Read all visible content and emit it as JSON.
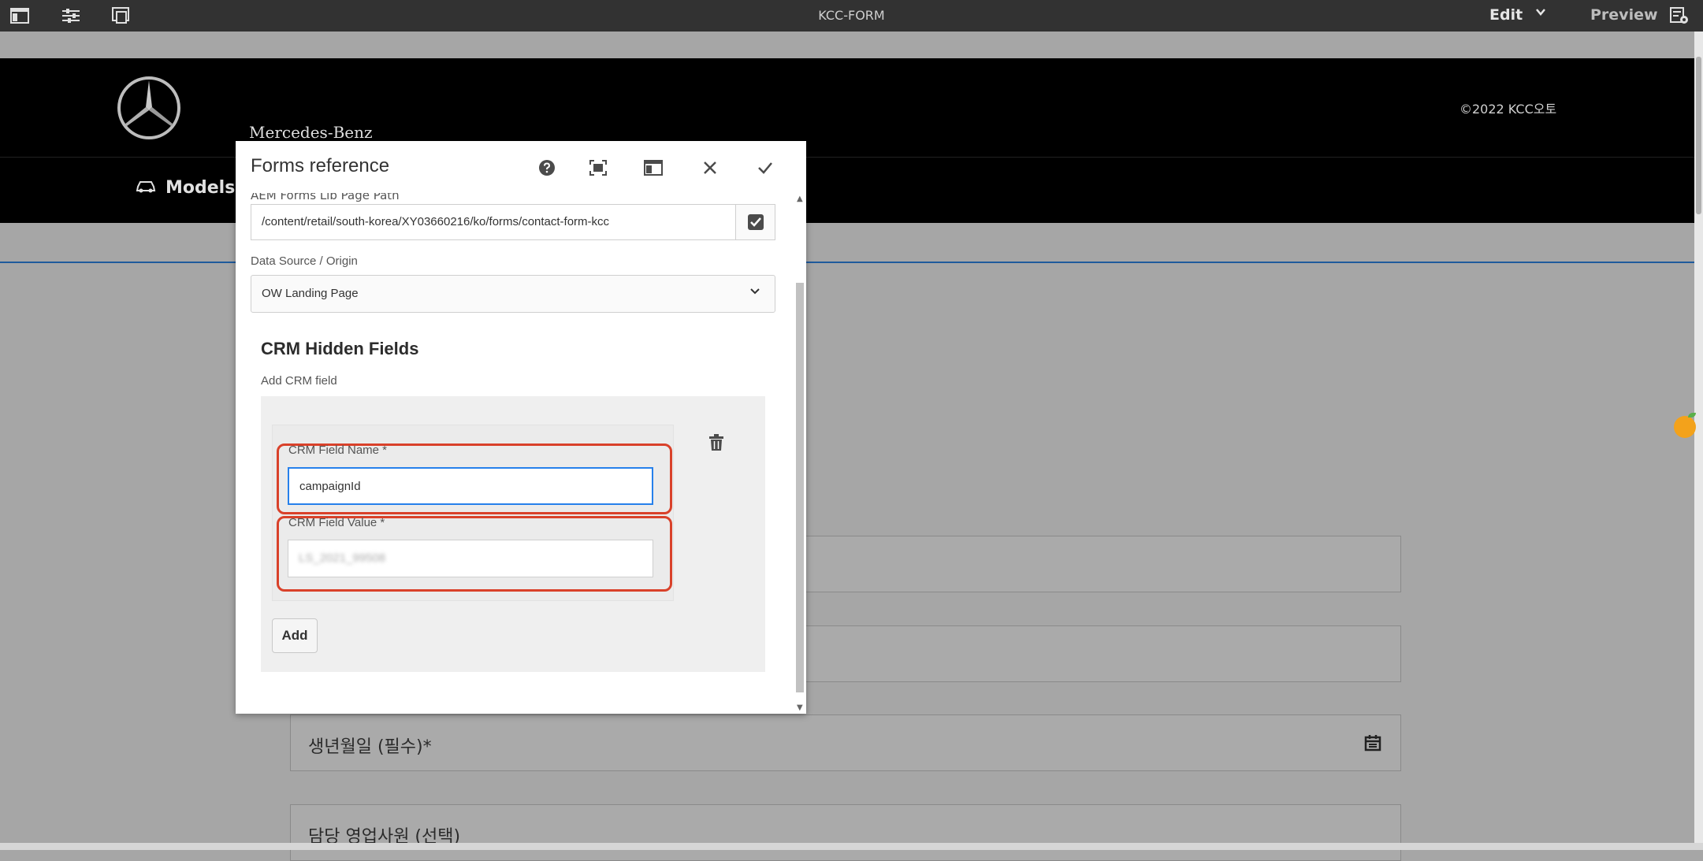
{
  "toolbar": {
    "title": "KCC-FORM",
    "mode_label": "Edit",
    "preview_label": "Preview",
    "icons": [
      "side-panel-icon",
      "properties-icon",
      "emulator-icon",
      "page-info-icon"
    ]
  },
  "page": {
    "brand": "Mercedes-Benz",
    "copyright": "©2022 KCC오토",
    "nav_models": "Models",
    "fields": [
      "생년월일 (필수)*",
      "담당 영업사원 (선택)"
    ]
  },
  "dialog": {
    "title": "Forms reference",
    "cut_label": "AEM Forms Lib Page Path",
    "path_value": "/content/retail/south-korea/XY03660216/ko/forms/contact-form-kcc",
    "datasource_label": "Data Source / Origin",
    "datasource_value": "OW Landing Page",
    "section_title": "CRM Hidden Fields",
    "add_field_label": "Add CRM field",
    "crm_name_label": "CRM Field Name *",
    "crm_name_value": "campaignId",
    "crm_value_label": "CRM Field Value *",
    "crm_value_value": "LS_2021_99508",
    "add_button": "Add"
  },
  "colors": {
    "highlight": "#d9412a",
    "focus_border": "#2680eb",
    "toolbar_bg": "#323232"
  }
}
